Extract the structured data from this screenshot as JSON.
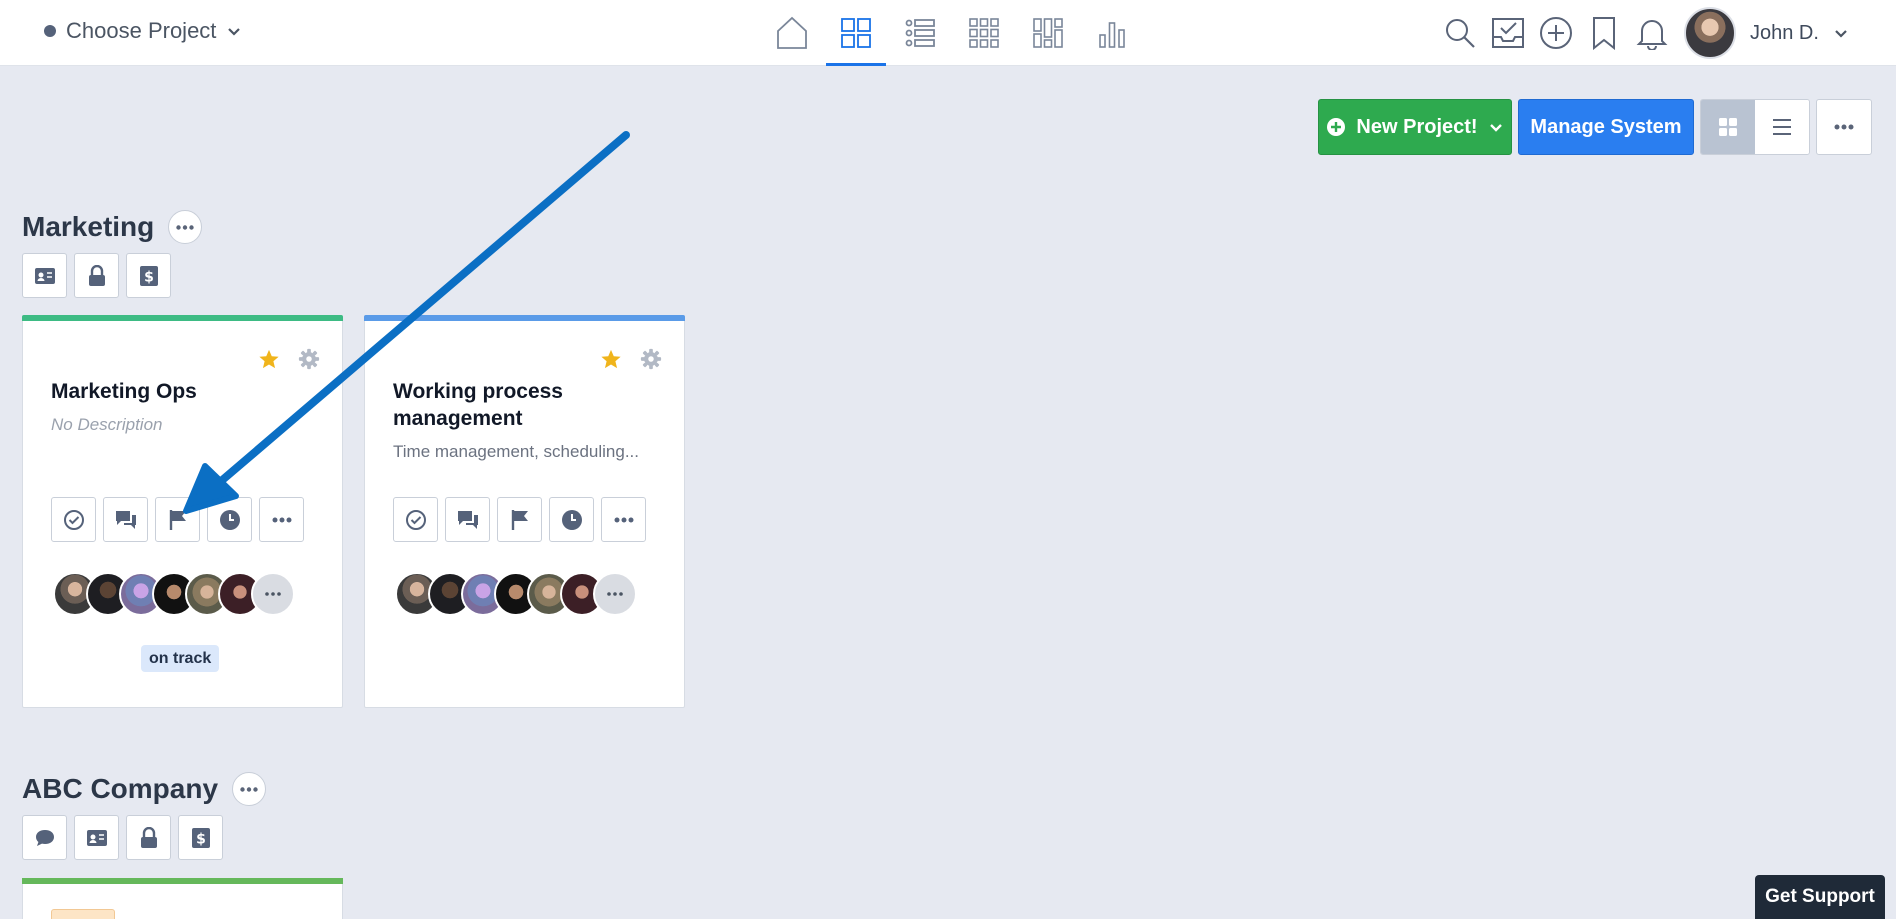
{
  "header": {
    "project_chooser_label": "Choose Project",
    "nav": [
      "home-icon",
      "boards-icon",
      "list-icon",
      "grid-icon",
      "columns-icon",
      "chart-icon"
    ],
    "user_name": "John D."
  },
  "toolbar": {
    "new_project_label": "New Project!",
    "manage_system_label": "Manage System"
  },
  "sections": [
    {
      "title": "Marketing",
      "chips": [
        "id-card-icon",
        "lock-icon",
        "dollar-icon"
      ],
      "cards": [
        {
          "title": "Marketing Ops",
          "description": "No Description",
          "status": "on track",
          "accent": "#3dbb84"
        },
        {
          "title": "Working process management",
          "description": "Time management, scheduling...",
          "status": "",
          "accent": "#5a9be8"
        }
      ]
    },
    {
      "title": "ABC Company",
      "chips": [
        "chat-icon",
        "id-card-icon",
        "lock-icon",
        "dollar-icon"
      ]
    }
  ],
  "support_label": "Get Support",
  "colors": {
    "primary": "#2a7ef0",
    "success": "#2eaa4f",
    "star": "#f0b41b",
    "arrow": "#0b6fc4"
  }
}
